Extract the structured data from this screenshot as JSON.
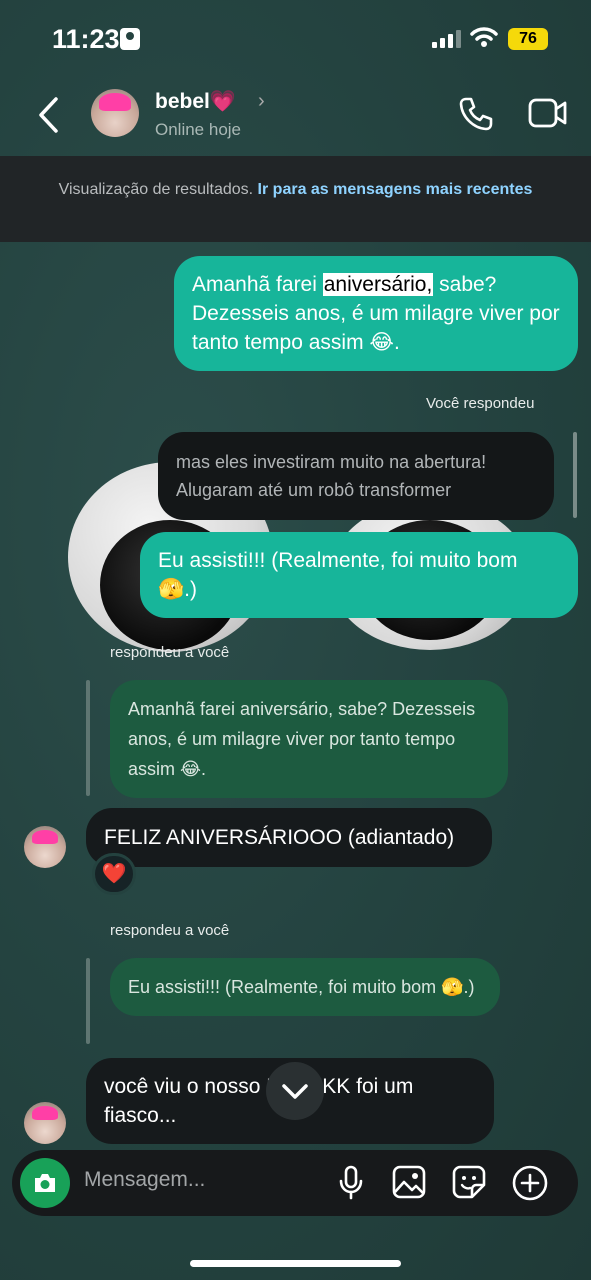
{
  "status_bar": {
    "time": "11:23",
    "battery": "76"
  },
  "header": {
    "name": "bebel💗",
    "status": "Online hoje"
  },
  "notice": {
    "text": "Visualização de resultados. ",
    "link": "Ir para as mensagens mais recentes"
  },
  "messages": {
    "m1": {
      "before": "Amanhã farei ",
      "highlight": "aniversário,",
      "after": " sabe? Dezesseis anos, é um milagre viver por tanto tempo assim 😂."
    },
    "reply_label_you": "Você respondeu",
    "m2_quoted": "mas eles investiram muito na abertura! Alugaram até um robô transformer",
    "m2": "Eu assisti!!! (Realmente, foi muito bom 🫣.)",
    "reply_label_her_1": "respondeu a você",
    "m3_quoted": "Amanhã farei aniversário, sabe? Dezesseis anos, é um milagre viver por tanto tempo assim 😂.",
    "m3": "FELIZ ANIVERSÁRIOOO (adiantado)",
    "m3_reaction": "❤️",
    "reply_label_her_2": "respondeu a você",
    "m4_quoted": "Eu assisti!!! (Realmente, foi muito bom 🫣.)",
    "m4": "você viu o nosso KKKKKK foi um fiasco..."
  },
  "composer": {
    "placeholder": "Mensagem..."
  },
  "colors": {
    "accent_teal": "#17b59a",
    "camera_green": "#18a158",
    "battery_yellow": "#f5d90a"
  }
}
